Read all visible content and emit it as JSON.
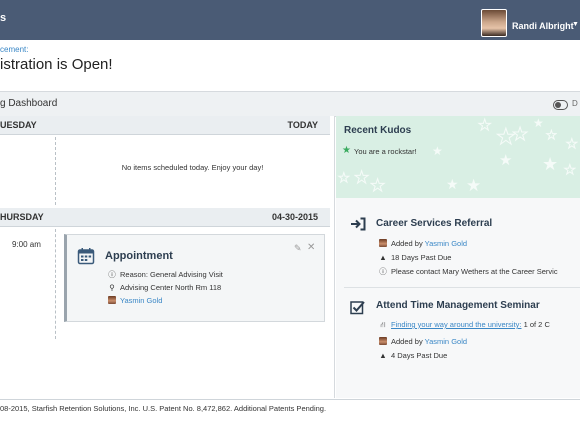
{
  "topbar": {
    "left_tab": "s",
    "user_name": "Randi Albright"
  },
  "announcement": {
    "label": "cement:",
    "text": "istration is Open!"
  },
  "dashbar": {
    "label": "g Dashboard",
    "toggle_label": "D"
  },
  "calendar": {
    "days": [
      {
        "left": "UESDAY",
        "right": "TODAY",
        "empty_text": "No items scheduled today. Enjoy your day!"
      },
      {
        "left": "HURSDAY",
        "right": "04-30-2015"
      }
    ],
    "appointment": {
      "time": "9:00 am",
      "title": "Appointment",
      "reason": "Reason: General Advising Visit",
      "location": "Advising Center North Rm 118",
      "person": "Yasmin Gold"
    }
  },
  "kudos": {
    "title": "Recent Kudos",
    "item": "You are a rockstar!"
  },
  "items": [
    {
      "title": "Career Services Referral",
      "added_prefix": "Added by",
      "added_by": "Yasmin Gold",
      "due": "18 Days Past Due",
      "note": "Please contact Mary Wethers at the Career Servic"
    },
    {
      "title": "Attend Time Management Seminar",
      "link": "Finding your way around the university:",
      "link_suffix": "1 of 2 C",
      "added_prefix": "Added by",
      "added_by": "Yasmin Gold",
      "due": "4 Days Past Due"
    }
  ],
  "footer": {
    "text": "08-2015, Starfish Retention Solutions, Inc. U.S. Patent No. 8,472,862. Additional Patents Pending."
  },
  "colors": {
    "topbar": "#4a5b75",
    "link": "#3a87c6",
    "kudos_bg": "#d9efe4",
    "kudos_star": "#3aab5f"
  }
}
